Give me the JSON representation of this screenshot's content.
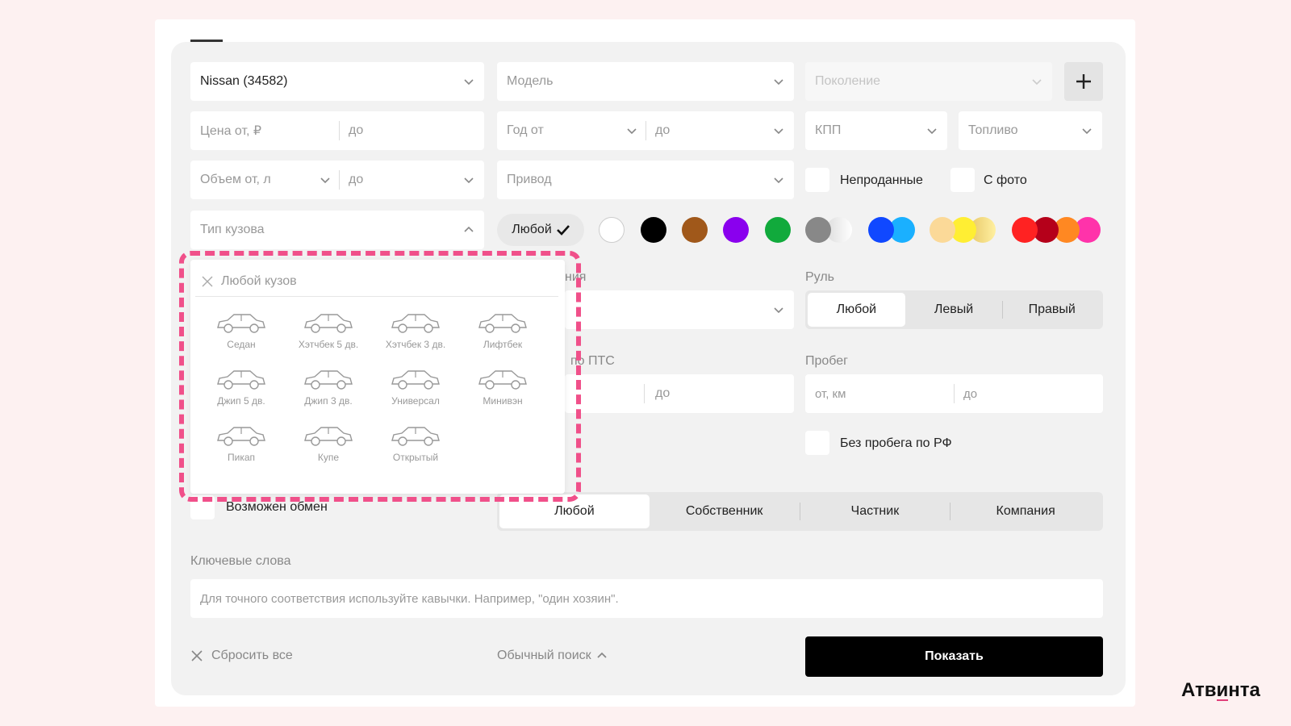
{
  "filters": {
    "brand": "Nissan (34582)",
    "model_placeholder": "Модель",
    "generation_placeholder": "Поколение",
    "price_from": "Цена от, ₽",
    "price_to": "до",
    "year_from": "Год от",
    "year_to": "до",
    "transmission": "КПП",
    "fuel": "Топливо",
    "volume_from": "Объем от, л",
    "volume_to": "до",
    "drive": "Привод",
    "unsold_label": "Непроданные",
    "with_photo_label": "С фото",
    "body_type_placeholder": "Тип кузова",
    "color_any": "Любой",
    "wheel_label": "Руль",
    "wheel_options": [
      "Любой",
      "Левый",
      "Правый"
    ],
    "pts_partial": "по ПТС",
    "owners_partial": "ния",
    "owners_to": "до",
    "mileage_label": "Пробег",
    "mileage_from": "от, км",
    "mileage_to": "до",
    "no_mileage_rf": "Без пробега по РФ",
    "exchange_label": "Возможен обмен",
    "seller_options": [
      "Любой",
      "Собственник",
      "Частник",
      "Компания"
    ],
    "keywords_label": "Ключевые слова",
    "keywords_placeholder": "Для точного соответствия используйте кавычки. Например, \"один хозяин\".",
    "reset_all": "Сбросить все",
    "simple_search": "Обычный поиск",
    "show_button": "Показать"
  },
  "colors": [
    "#ffffff",
    "#000000",
    "#a0581a",
    "#8a00ee",
    "#11aa3c",
    "#888888",
    "#1565ff",
    "#ffe066",
    "#ee2222"
  ],
  "body_dropdown": {
    "any_body": "Любой кузов",
    "types": [
      "Седан",
      "Хэтчбек 5 дв.",
      "Хэтчбек 3 дв.",
      "Лифтбек",
      "Джип 5 дв.",
      "Джип 3 дв.",
      "Универсал",
      "Минивэн",
      "Пикап",
      "Купе",
      "Открытый"
    ]
  },
  "brand_logo": "Атвинта"
}
